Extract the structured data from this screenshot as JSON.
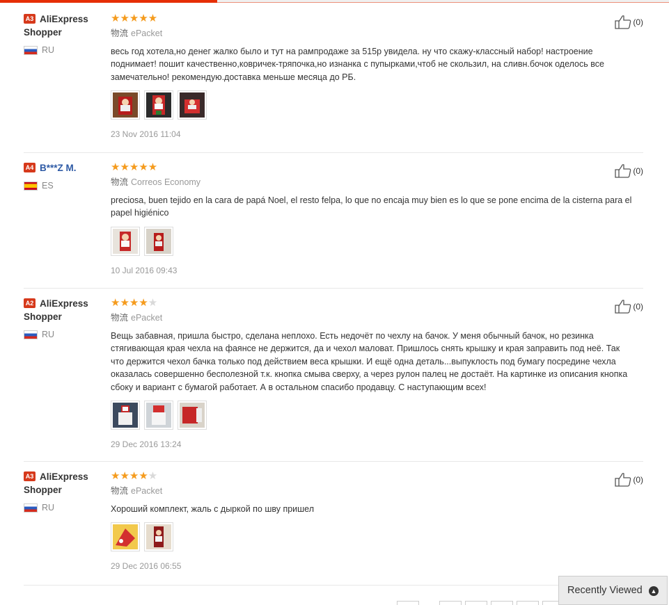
{
  "reviews": [
    {
      "level": "A3",
      "user_name": "AliExpress Shopper",
      "country": "RU",
      "rating": 5,
      "logistics_label": "物流",
      "logistics": "ePacket",
      "text": "весь год хотела,но денег жалко было и тут на рампродаже за 515р увидела. ну что скажу-классный набор! настроение поднимает! пошит качественно,ковричек-тряпочка,но изнанка с пупырками,чтоб не скользил, на сливн.бочок оделось все замечательно! рекомендую.доставка меньше месяца до РБ.",
      "date": "23 Nov 2016 11:04",
      "helpful": "(0)"
    },
    {
      "level": "A4",
      "user_name": "B***Z M.",
      "country": "ES",
      "rating": 5,
      "logistics_label": "物流",
      "logistics": "Correos Economy",
      "text": "preciosa, buen tejido en la cara de papá Noel, el resto felpa, lo que no encaja muy bien es lo que se pone encima de la cisterna para el papel higiénico",
      "date": "10 Jul 2016 09:43",
      "helpful": "(0)"
    },
    {
      "level": "A2",
      "user_name": "AliExpress Shopper",
      "country": "RU",
      "rating": 4,
      "logistics_label": "物流",
      "logistics": "ePacket",
      "text": "Вещь забавная, пришла быстро, сделана неплохо. Есть недочёт по чехлу на бачок. У меня обычный бачок, но резинка стягивающая края чехла на фаянсе не держится, да и чехол маловат. Пришлось снять крышку и края заправить под неё. Так что держится чехол бачка только под действием веса крышки. И ещё одна деталь...выпуклость под бумагу посредине чехла оказалась совершенно бесполезной т.к. кнопка смыва сверху, а через рулон палец не достаёт. На картинке из описания кнопка сбоку и вариант с бумагой работает. А в остальном спасибо продавцу. С наступающим всех!",
      "date": "29 Dec 2016 13:24",
      "helpful": "(0)"
    },
    {
      "level": "A3",
      "user_name": "AliExpress Shopper",
      "country": "RU",
      "rating": 4,
      "logistics_label": "物流",
      "logistics": "ePacket",
      "text": "Хороший комплект, жаль с дыркой по шву пришел",
      "date": "29 Dec 2016 06:55",
      "helpful": "(0)"
    }
  ],
  "recently_viewed": "Recently Viewed",
  "colors": {
    "accent": "#e62e04",
    "star": "#f59b1d",
    "level_badge": "#d6391b",
    "blue_name": "#2e5aa5"
  }
}
